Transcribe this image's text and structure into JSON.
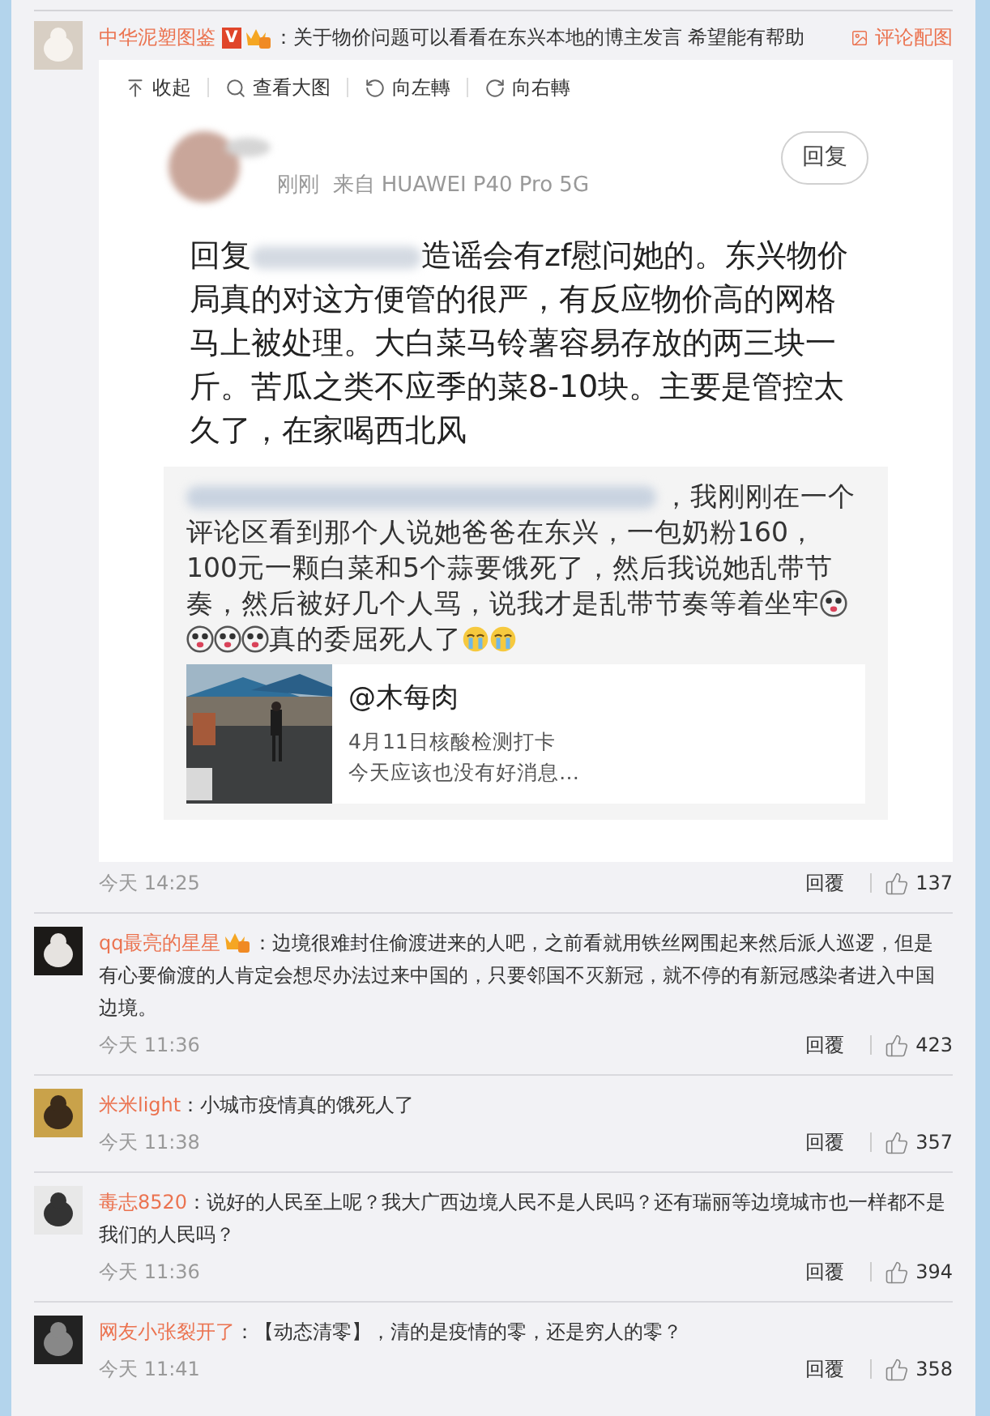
{
  "post": {
    "author": "中华泥塑图鉴",
    "badge": "V",
    "text": "：关于物价问题可以看看在东兴本地的博主发言 希望能有帮助",
    "action": "评论配图"
  },
  "viewer": {
    "toolbar": [
      {
        "kind": "collapse",
        "label": "收起"
      },
      {
        "kind": "zoom",
        "label": "查看大图"
      },
      {
        "kind": "rotate_left",
        "label": "向左轉"
      },
      {
        "kind": "rotate_right",
        "label": "向右轉"
      }
    ],
    "screenshot": {
      "time": "刚刚",
      "source": "来自 HUAWEI P40 Pro 5G",
      "reply_button": "回复",
      "text_before": "回复",
      "text_after": "造谣会有zf慰问她的。东兴物价局真的对这方便管的很严，有反应物价高的网格马上被处理。大白菜马铃薯容易存放的两三块一斤。苦瓜之类不应季的菜8-10块。主要是管控太久了，在家喝西北风",
      "quote": [
        {
          "kind": "blur"
        },
        {
          "kind": "text",
          "text": "，我刚刚在一个评论区看到那个人说她爸爸在东兴，一包奶粉160，100元一颗白菜和5个蒜要饿死了，然后我说她乱带节奏，然后被好几个人骂，说我才是乱带节奏等着坐牢"
        },
        {
          "kind": "emoji"
        },
        {
          "kind": "emoji"
        },
        {
          "kind": "emoji"
        },
        {
          "kind": "emoji"
        },
        {
          "kind": "text",
          "text": "真的委屈死人了"
        },
        {
          "kind": "cry"
        },
        {
          "kind": "cry"
        }
      ],
      "card": {
        "title": "@木每肉",
        "line_1": "4月11日核酸检测打卡",
        "line_2": "今天应该也没有好消息…"
      }
    }
  },
  "footer": {
    "time": "今天 14:25",
    "reply": "回覆",
    "likes": "137"
  },
  "comments": [
    {
      "author": "qq最亮的星星",
      "badge": true,
      "text": "：边境很难封住偷渡进来的人吧，之前看就用铁丝网围起来然后派人巡逻，但是有心要偷渡的人肯定会想尽办法过来中国的，只要邻国不灭新冠，就不停的有新冠感染者进入中国边境。",
      "time": "今天 11:36",
      "reply": "回覆",
      "likes": "423"
    },
    {
      "author": "米米light",
      "badge": false,
      "text": "：小城市疫情真的饿死人了",
      "time": "今天 11:38",
      "reply": "回覆",
      "likes": "357"
    },
    {
      "author": "毒志8520",
      "badge": false,
      "text": "：说好的人民至上呢？我大广西边境人民不是人民吗？还有瑞丽等边境城市也一样都不是我们的人民吗？",
      "time": "今天 11:36",
      "reply": "回覆",
      "likes": "394"
    },
    {
      "author": "网友小张裂开了",
      "badge": false,
      "text": "：【动态清零】，清的是疫情的零，还是穷人的零？",
      "time": "今天 11:41",
      "reply": "回覆",
      "likes": "358"
    }
  ]
}
